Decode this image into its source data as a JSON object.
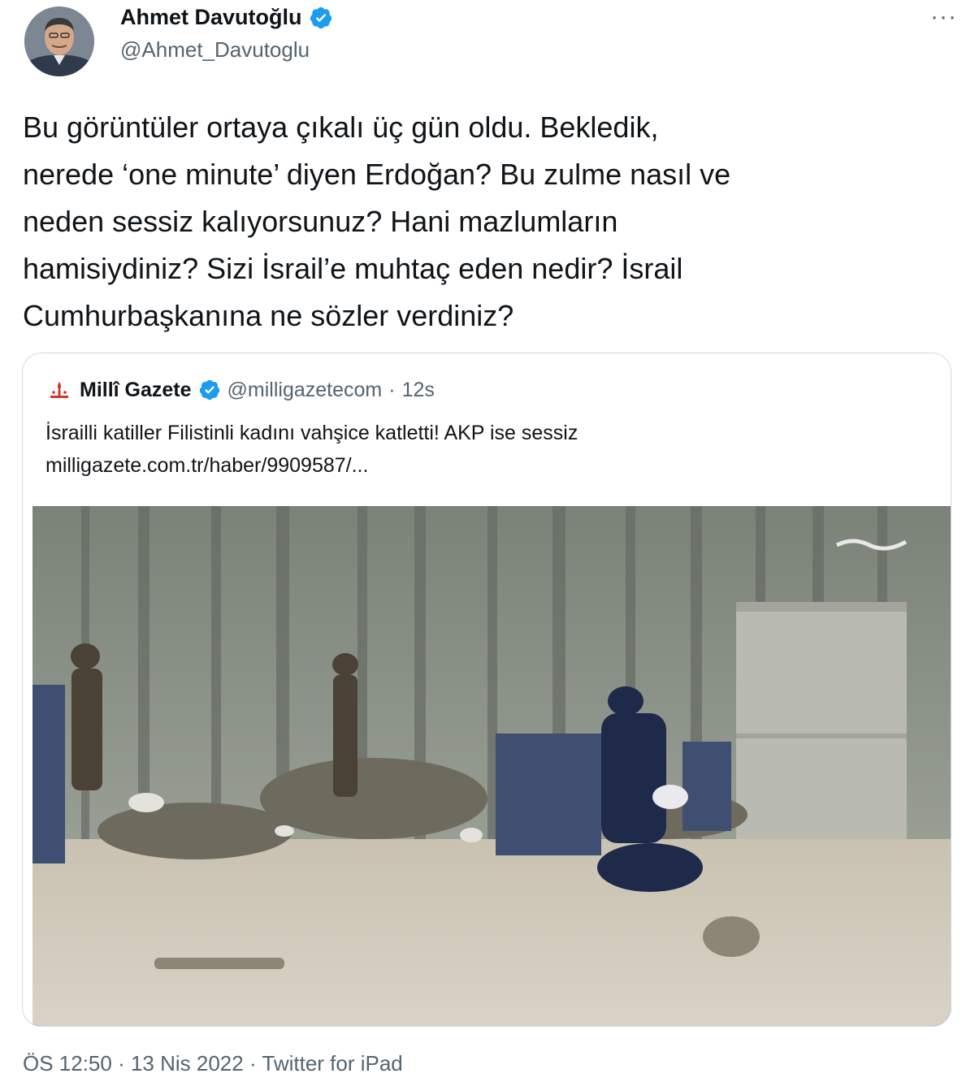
{
  "author": {
    "name": "Ahmet Davutoğlu",
    "handle": "@Ahmet_Davutoglu",
    "verified": true
  },
  "menu": {
    "more_label": "···"
  },
  "tweet": {
    "text": "Bu görüntüler ortaya çıkalı üç gün oldu. Bekledik,\nnerede ‘one minute’ diyen Erdoğan? Bu zulme nasıl ve\nneden sessiz kalıyorsunuz? Hani mazlumların\nhamisiydiniz? Sizi İsrail’e muhtaç eden nedir? İsrail\nCumhurbaşkanına ne sözler verdiniz?"
  },
  "quote": {
    "name": "Millî Gazete",
    "handle": "@milligazetecom",
    "separator": "·",
    "time": "12s",
    "text": "İsrailli katiller Filistinli kadını vahşice katletti! AKP ise sessiz",
    "link": "milligazete.com.tr/haber/9909587/..."
  },
  "footer": {
    "time": "ÖS 12:50",
    "sep1": " · ",
    "date": "13 Nis 2022",
    "sep2": " · ",
    "source": "Twitter for iPad"
  },
  "colors": {
    "verified": "#1d9bf0",
    "text": "#0f1419",
    "secondary": "#536471",
    "border": "#cfd9de"
  },
  "icons": [
    "verified-badge-icon",
    "more-options-icon",
    "milli-gazete-logo"
  ]
}
